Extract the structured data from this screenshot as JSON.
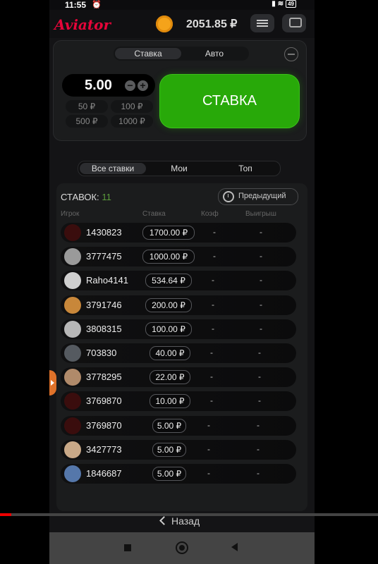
{
  "status": {
    "time": "11:55",
    "battery": "49"
  },
  "header": {
    "logo": "Aviator",
    "balance": "2051.85 ₽"
  },
  "bet_panel": {
    "tabs": [
      "Ставка",
      "Авто"
    ],
    "amount": "5.00",
    "quick_amounts": [
      "50 ₽",
      "100 ₽",
      "500 ₽",
      "1000 ₽"
    ],
    "bet_button": "СТАВКА"
  },
  "bets_tabs": [
    "Все ставки",
    "Мои",
    "Топ"
  ],
  "list": {
    "count_label": "СТАВОК:",
    "count": "11",
    "previous_button": "Предыдущий",
    "columns": [
      "Игрок",
      "Ставка",
      "Коэф",
      "Выигрыш"
    ],
    "rows": [
      {
        "player": "1430823",
        "bet": "1700.00 ₽",
        "coef": "-",
        "win": "-"
      },
      {
        "player": "3777475",
        "bet": "1000.00 ₽",
        "coef": "-",
        "win": "-"
      },
      {
        "player": "Raho4141",
        "bet": "534.64 ₽",
        "coef": "-",
        "win": "-"
      },
      {
        "player": "3791746",
        "bet": "200.00 ₽",
        "coef": "-",
        "win": "-"
      },
      {
        "player": "3808315",
        "bet": "100.00 ₽",
        "coef": "-",
        "win": "-"
      },
      {
        "player": "703830",
        "bet": "40.00 ₽",
        "coef": "-",
        "win": "-"
      },
      {
        "player": "3778295",
        "bet": "22.00 ₽",
        "coef": "-",
        "win": "-"
      },
      {
        "player": "3769870",
        "bet": "10.00 ₽",
        "coef": "-",
        "win": "-"
      },
      {
        "player": "3769870",
        "bet": "5.00 ₽",
        "coef": "-",
        "win": "-"
      },
      {
        "player": "3427773",
        "bet": "5.00 ₽",
        "coef": "-",
        "win": "-"
      },
      {
        "player": "1846687",
        "bet": "5.00 ₽",
        "coef": "-",
        "win": "-"
      }
    ]
  },
  "avatar_colors": [
    "#3a0d0d",
    "#9a9a9a",
    "#cfcfcf",
    "#c8873a",
    "#b7b7b7",
    "#555a60",
    "#b08a6a",
    "#3a0d0d",
    "#3a0d0d",
    "#c9a988",
    "#5577aa"
  ],
  "video": {
    "back_label": "Назад",
    "progress": 0.03
  }
}
